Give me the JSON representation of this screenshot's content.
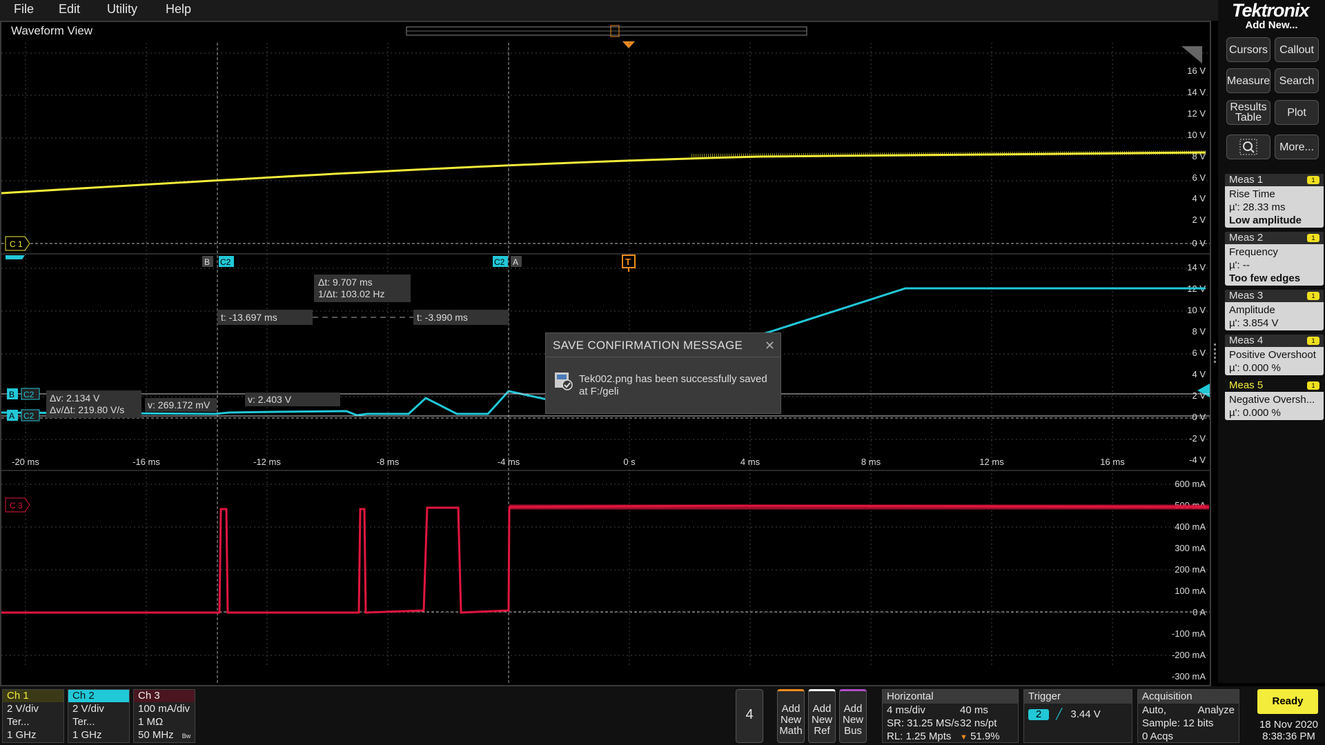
{
  "menu": [
    "File",
    "Edit",
    "Utility",
    "Help"
  ],
  "brand": "Tektronix",
  "sidebar": {
    "add_new": "Add New...",
    "buttons": [
      "Cursors",
      "Callout",
      "Measure",
      "Search",
      "Results Table",
      "Plot",
      "More..."
    ],
    "zoom_icon": "zoom-icon",
    "measurements": [
      {
        "name": "Meas 1",
        "type": "Rise Time",
        "value": "µ': 28.33 ms",
        "note": "Low amplitude"
      },
      {
        "name": "Meas 2",
        "type": "Frequency",
        "value": "µ': --",
        "note": "Too few edges"
      },
      {
        "name": "Meas 3",
        "type": "Amplitude",
        "value": "µ': 3.854 V",
        "note": ""
      },
      {
        "name": "Meas 4",
        "type": "Positive Overshoot",
        "value": "µ': 0.000 %",
        "note": ""
      },
      {
        "name": "Meas 5",
        "type": "Negative Oversh...",
        "value": "µ': 0.000 %",
        "note": ""
      }
    ],
    "badge": "1"
  },
  "waveform": {
    "title": "Waveform View",
    "ch1_axis": [
      "16 V",
      "14 V",
      "12 V",
      "10 V",
      "8 V",
      "6 V",
      "4 V",
      "2 V",
      "0 V"
    ],
    "ch2_axis": [
      "14 V",
      "12 V",
      "10 V",
      "8 V",
      "6 V",
      "4 V",
      "2 V",
      "0 V",
      "-2 V",
      "-4 V"
    ],
    "ch3_axis": [
      "600 mA",
      "500 mA",
      "400 mA",
      "300 mA",
      "200 mA",
      "100 mA",
      "0 A",
      "-100 mA",
      "-200 mA",
      "-300 mA"
    ],
    "time_axis": [
      "-20 ms",
      "-16 ms",
      "-12 ms",
      "-8 ms",
      "-4 ms",
      "0 s",
      "4 ms",
      "8 ms",
      "12 ms",
      "16 ms"
    ],
    "labels": {
      "c1": "C 1",
      "c3": "C 3",
      "c2": "C2",
      "a": "A",
      "b": "B",
      "t": "T"
    },
    "cursor": {
      "delta_t": "Δt: 9.707 ms",
      "inv_delta_t": "1/Δt: 103.02 Hz",
      "t_b": "t: -13.697 ms",
      "t_a": "t: -3.990 ms",
      "delta_v": "Δv: 2.134 V",
      "dv_dt": "Δv/Δt: 219.80 V/s",
      "v_b": "v: 269.172 mV",
      "v_a": "v: 2.403 V"
    }
  },
  "dialog": {
    "title": "SAVE CONFIRMATION MESSAGE",
    "close": "✕",
    "message": "Tek002.png has been successfully saved at F:/geli"
  },
  "bottom": {
    "channels": [
      {
        "name": "Ch 1",
        "scale": "2 V/div",
        "term": "Ter...",
        "bw": "1 GHz",
        "color": "#f4ec3a"
      },
      {
        "name": "Ch 2",
        "scale": "2 V/div",
        "term": "Ter...",
        "bw": "1 GHz",
        "color": "#21c8d8"
      },
      {
        "name": "Ch 3",
        "scale": "100 mA/div",
        "term": "1 MΩ",
        "bw": "50 MHz",
        "color": "#e0163e"
      }
    ],
    "ch3_bw_mark": "Bw",
    "channel_count": "4",
    "add_math": "Add New Math",
    "add_ref": "Add New Ref",
    "add_bus": "Add New Bus",
    "horizontal": {
      "title": "Horizontal",
      "scale": "4 ms/div",
      "duration": "40 ms",
      "sr": "SR: 31.25 MS/s",
      "pt": "32 ns/pt",
      "rl": "RL: 1.25 Mpts",
      "pos": "51.9%"
    },
    "trigger": {
      "title": "Trigger",
      "source": "2",
      "level": "3.44 V"
    },
    "acquisition": {
      "title": "Acquisition",
      "mode": "Auto,",
      "analyze": "Analyze",
      "sample": "Sample: 12 bits",
      "acqs": "0 Acqs"
    },
    "status": "Ready",
    "date": "18 Nov 2020",
    "time": "8:38:36 PM"
  },
  "colors": {
    "ch1": "#f4ec3a",
    "ch2": "#21c8d8",
    "ch3": "#e0163e",
    "trigger": "#f08c1e"
  }
}
